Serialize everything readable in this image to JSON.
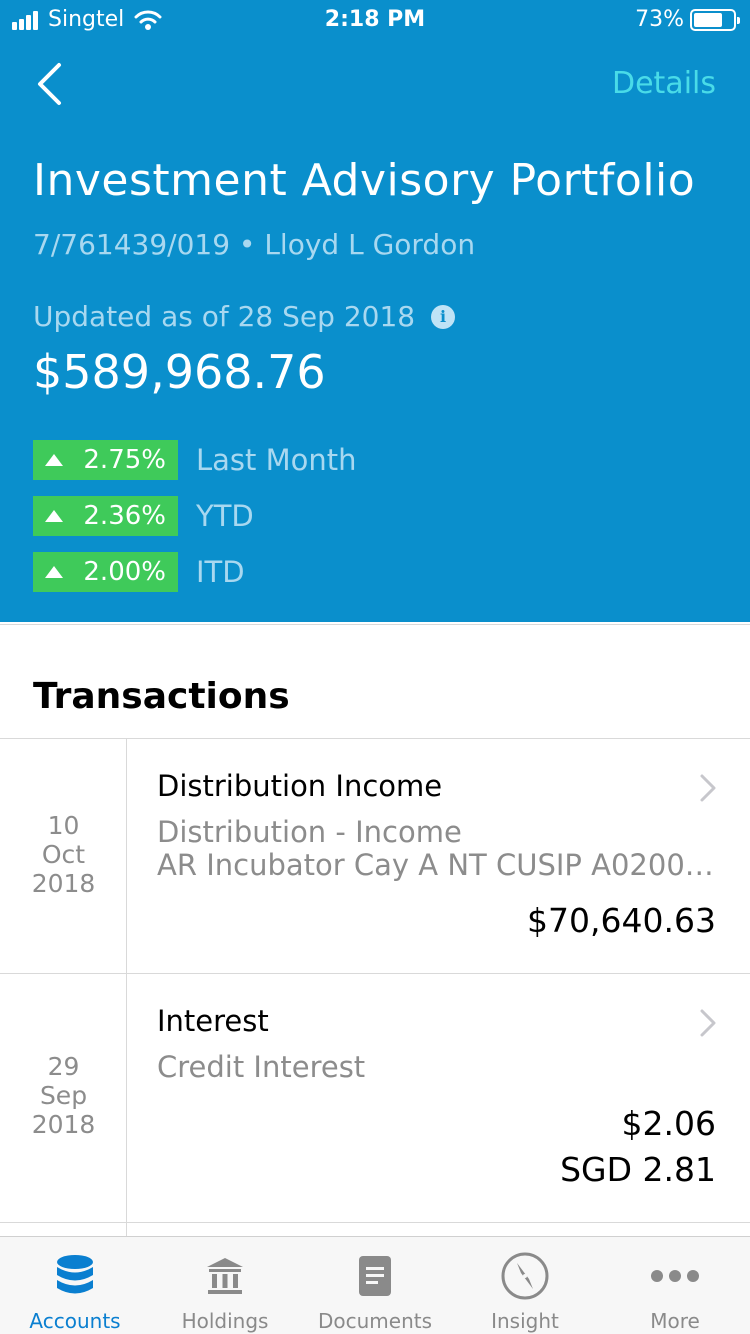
{
  "status_bar": {
    "carrier": "Singtel",
    "time": "2:18 PM",
    "battery": "73%",
    "battery_level": 0.73
  },
  "nav": {
    "details_label": "Details"
  },
  "account": {
    "title": "Investment Advisory Portfolio",
    "subtitle": "7/761439/019 • Lloyd L Gordon",
    "updated": "Updated as of 28 Sep 2018",
    "total": "$589,968.76",
    "performance": [
      {
        "value": "2.75%",
        "label": "Last Month"
      },
      {
        "value": "2.36%",
        "label": "YTD"
      },
      {
        "value": "2.00%",
        "label": "ITD"
      }
    ]
  },
  "transactions": {
    "title": "Transactions",
    "items": [
      {
        "day": "10",
        "month": "Oct",
        "year": "2018",
        "title": "Distribution Income",
        "desc1": "Distribution - Income",
        "desc2": "AR Incubator Cay A NT CUSIP A0200…",
        "amount": "$70,640.63"
      },
      {
        "day": "29",
        "month": "Sep",
        "year": "2018",
        "title": "Interest",
        "desc1": "Credit Interest",
        "amount": "$2.06",
        "amount2": "SGD 2.81"
      }
    ]
  },
  "tabs": [
    {
      "label": "Accounts",
      "icon": "database-icon",
      "active": true
    },
    {
      "label": "Holdings",
      "icon": "bank-icon"
    },
    {
      "label": "Documents",
      "icon": "document-icon"
    },
    {
      "label": "Insight",
      "icon": "compass-icon"
    },
    {
      "label": "More",
      "icon": "more-dots-icon"
    }
  ],
  "colors": {
    "header": "#0a8fcc",
    "accent": "#49dbe8",
    "positive": "#3fca5a",
    "active_tab": "#0a7fd0"
  }
}
